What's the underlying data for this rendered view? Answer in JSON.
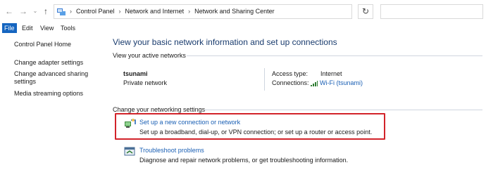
{
  "address": {
    "crumbs": [
      "Control Panel",
      "Network and Internet",
      "Network and Sharing Center"
    ],
    "search_placeholder": ""
  },
  "menu": [
    "File",
    "Edit",
    "View",
    "Tools"
  ],
  "sidebar": {
    "items": [
      {
        "label": "Control Panel Home"
      },
      {
        "label": "Change adapter settings"
      },
      {
        "label": "Change advanced sharing settings"
      },
      {
        "label": "Media streaming options"
      }
    ]
  },
  "main": {
    "heading": "View your basic network information and set up connections",
    "active_networks_label": "View your active networks",
    "network": {
      "name": "tsunami",
      "type": "Private network",
      "access_type_label": "Access type:",
      "access_type_value": "Internet",
      "connections_label": "Connections:",
      "connections_value": "Wi-Fi (tsunami)"
    },
    "change_settings_label": "Change your networking settings",
    "tasks": [
      {
        "title": "Set up a new connection or network",
        "description": "Set up a broadband, dial-up, or VPN connection; or set up a router or access point."
      },
      {
        "title": "Troubleshoot problems",
        "description": "Diagnose and repair network problems, or get troubleshooting information."
      }
    ]
  },
  "colors": {
    "link": "#1a5fb4",
    "heading": "#1a3c6e",
    "highlight_border": "#d2232a",
    "menu_active": "#1565c0"
  }
}
